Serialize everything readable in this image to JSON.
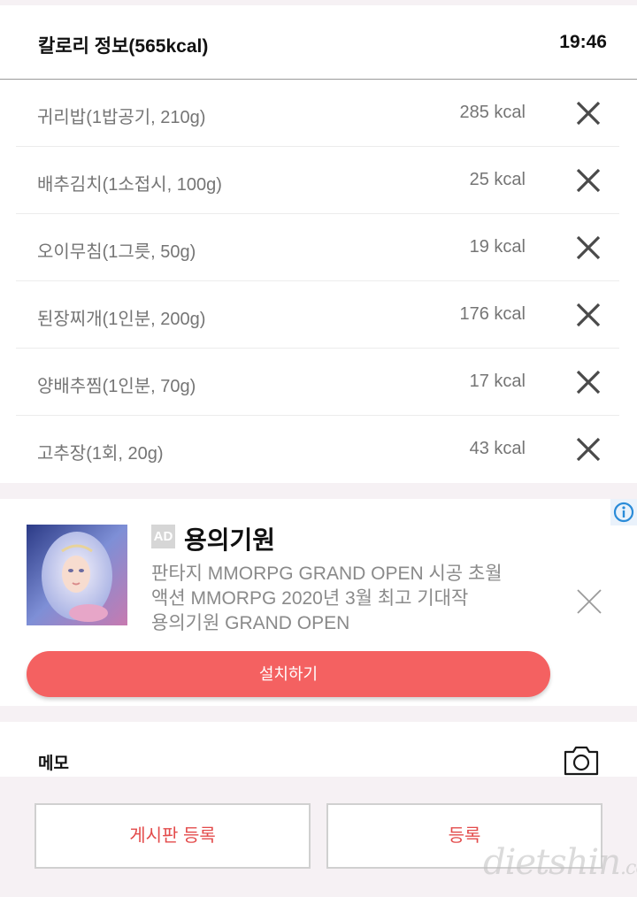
{
  "header": {
    "title": "칼로리 정보(565kcal)",
    "time": "19:46"
  },
  "foods": [
    {
      "name": "귀리밥(1밥공기, 210g)",
      "kcal": "285 kcal"
    },
    {
      "name": "배추김치(1소접시, 100g)",
      "kcal": "25 kcal"
    },
    {
      "name": "오이무침(1그릇, 50g)",
      "kcal": "19 kcal"
    },
    {
      "name": "된장찌개(1인분, 200g)",
      "kcal": "176 kcal"
    },
    {
      "name": "양배추찜(1인분, 70g)",
      "kcal": "17 kcal"
    },
    {
      "name": "고추장(1회, 20g)",
      "kcal": "43 kcal"
    }
  ],
  "ad": {
    "badge": "AD",
    "title": "용의기원",
    "lines": [
      "판타지 MMORPG GRAND OPEN 시공 초월",
      "액션 MMORPG 2020년 3월 최고 기대작",
      "용의기원 GRAND OPEN"
    ],
    "install_label": "설치하기",
    "accent_color": "#f46161"
  },
  "memo": {
    "label": "메모"
  },
  "buttons": {
    "board_label": "게시판 등록",
    "register_label": "등록"
  },
  "watermark": {
    "main": "dietshin",
    "suffix": ".com"
  }
}
